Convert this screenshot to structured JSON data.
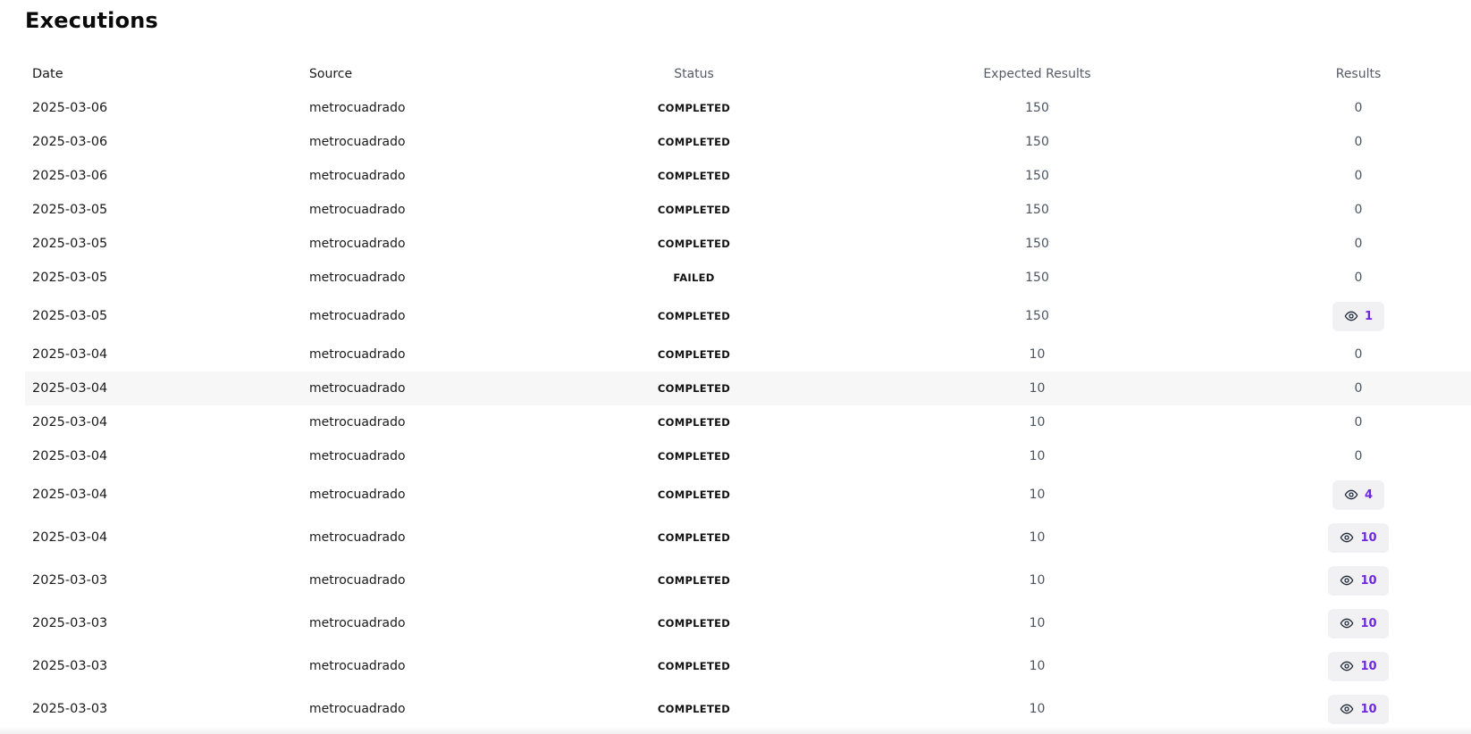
{
  "page": {
    "title": "Executions"
  },
  "table": {
    "headers": {
      "date": "Date",
      "source": "Source",
      "status": "Status",
      "expected": "Expected Results",
      "results": "Results"
    },
    "rows": [
      {
        "date": "2025-03-06",
        "source": "metrocuadrado",
        "status": "COMPLETED",
        "expected": "150",
        "results": "0",
        "results_link": false
      },
      {
        "date": "2025-03-06",
        "source": "metrocuadrado",
        "status": "COMPLETED",
        "expected": "150",
        "results": "0",
        "results_link": false
      },
      {
        "date": "2025-03-06",
        "source": "metrocuadrado",
        "status": "COMPLETED",
        "expected": "150",
        "results": "0",
        "results_link": false
      },
      {
        "date": "2025-03-05",
        "source": "metrocuadrado",
        "status": "COMPLETED",
        "expected": "150",
        "results": "0",
        "results_link": false
      },
      {
        "date": "2025-03-05",
        "source": "metrocuadrado",
        "status": "COMPLETED",
        "expected": "150",
        "results": "0",
        "results_link": false
      },
      {
        "date": "2025-03-05",
        "source": "metrocuadrado",
        "status": "FAILED",
        "expected": "150",
        "results": "0",
        "results_link": false
      },
      {
        "date": "2025-03-05",
        "source": "metrocuadrado",
        "status": "COMPLETED",
        "expected": "150",
        "results": "1",
        "results_link": true
      },
      {
        "date": "2025-03-04",
        "source": "metrocuadrado",
        "status": "COMPLETED",
        "expected": "10",
        "results": "0",
        "results_link": false
      },
      {
        "date": "2025-03-04",
        "source": "metrocuadrado",
        "status": "COMPLETED",
        "expected": "10",
        "results": "0",
        "results_link": false,
        "highlighted": true
      },
      {
        "date": "2025-03-04",
        "source": "metrocuadrado",
        "status": "COMPLETED",
        "expected": "10",
        "results": "0",
        "results_link": false
      },
      {
        "date": "2025-03-04",
        "source": "metrocuadrado",
        "status": "COMPLETED",
        "expected": "10",
        "results": "0",
        "results_link": false
      },
      {
        "date": "2025-03-04",
        "source": "metrocuadrado",
        "status": "COMPLETED",
        "expected": "10",
        "results": "4",
        "results_link": true
      },
      {
        "date": "2025-03-04",
        "source": "metrocuadrado",
        "status": "COMPLETED",
        "expected": "10",
        "results": "10",
        "results_link": true
      },
      {
        "date": "2025-03-03",
        "source": "metrocuadrado",
        "status": "COMPLETED",
        "expected": "10",
        "results": "10",
        "results_link": true
      },
      {
        "date": "2025-03-03",
        "source": "metrocuadrado",
        "status": "COMPLETED",
        "expected": "10",
        "results": "10",
        "results_link": true
      },
      {
        "date": "2025-03-03",
        "source": "metrocuadrado",
        "status": "COMPLETED",
        "expected": "10",
        "results": "10",
        "results_link": true
      },
      {
        "date": "2025-03-03",
        "source": "metrocuadrado",
        "status": "COMPLETED",
        "expected": "10",
        "results": "10",
        "results_link": true
      }
    ]
  },
  "icons": {
    "results_button_icon": "eye-icon"
  },
  "colors": {
    "results_count": "#6d28d9",
    "results_button_bg": "#f1f1f3",
    "hover_row_bg": "#f7f7f8"
  }
}
